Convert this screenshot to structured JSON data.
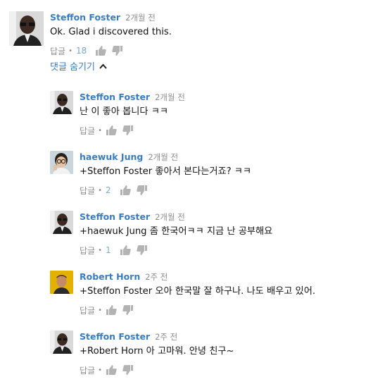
{
  "top": {
    "author": "Steffon Foster",
    "time": "2개월 전",
    "text": "Ok. Glad i discovered this.",
    "reply_label": "답글",
    "likes": "18"
  },
  "replies_toggle_label": "댓글 숨기기",
  "replies": [
    {
      "author": "Steffon Foster",
      "time": "2개월 전",
      "text": "난 이 좋아 봅니다 ㅋㅋ",
      "reply_label": "답글",
      "likes": ""
    },
    {
      "author": "haewuk Jung",
      "time": "2개월 전",
      "text": "+Steffon Foster 좋아서 본다는거죠? ㅋㅋ",
      "reply_label": "답글",
      "likes": "2"
    },
    {
      "author": "Steffon Foster",
      "time": "2개월 전",
      "text": "+haewuk Jung 좀 한국어ㅋㅋ 지금 난 공부해요",
      "reply_label": "답글",
      "likes": "1"
    },
    {
      "author": "Robert Horn",
      "time": "2주 전",
      "text": "+Steffon Foster 오아 한국말 잘 하구나. 나도 배우고 있어.",
      "reply_label": "답글",
      "likes": ""
    },
    {
      "author": "Steffon Foster",
      "time": "2주 전",
      "text": "+Robert Horn 아 고마워. 안녕 친구~",
      "reply_label": "답글",
      "likes": ""
    }
  ],
  "colors": {
    "author": "#3a7cc1",
    "meta": "#8d8d8d",
    "like_count": "#7aa8d6",
    "icon": "#b3b3b3"
  }
}
